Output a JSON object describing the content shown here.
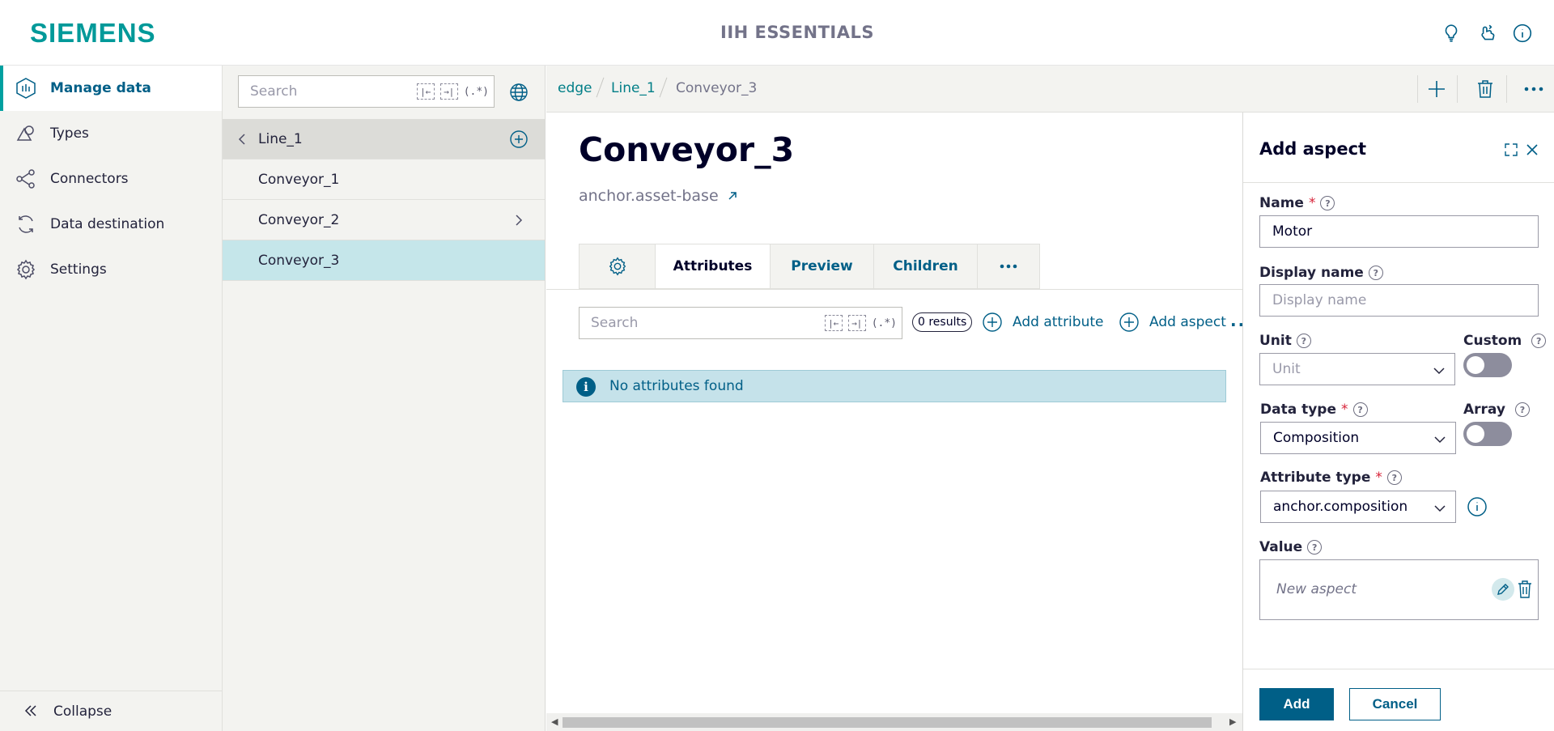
{
  "header": {
    "logo": "SIEMENS",
    "app_title": "IIH ESSENTIALS",
    "icons": [
      "lightbulb-icon",
      "user-support-icon",
      "info-icon"
    ]
  },
  "nav": {
    "items": [
      {
        "label": "Manage data",
        "icon": "manage-data-icon",
        "active": true
      },
      {
        "label": "Types",
        "icon": "types-icon",
        "active": false
      },
      {
        "label": "Connectors",
        "icon": "connectors-icon",
        "active": false
      },
      {
        "label": "Data destination",
        "icon": "data-destination-icon",
        "active": false
      },
      {
        "label": "Settings",
        "icon": "settings-icon",
        "active": false
      }
    ],
    "collapse_label": "Collapse"
  },
  "tree": {
    "search_placeholder": "Search",
    "regex_label": "(.*)",
    "parent": "Line_1",
    "items": [
      {
        "label": "Conveyor_1",
        "has_children": false,
        "selected": false
      },
      {
        "label": "Conveyor_2",
        "has_children": true,
        "selected": false
      },
      {
        "label": "Conveyor_3",
        "has_children": false,
        "selected": true
      }
    ]
  },
  "breadcrumb": {
    "items": [
      "edge",
      "Line_1",
      "Conveyor_3"
    ]
  },
  "main": {
    "title": "Conveyor_3",
    "subtitle": "anchor.asset-base",
    "tabs": [
      "Attributes",
      "Preview",
      "Children"
    ],
    "active_tab": "Attributes",
    "search_placeholder": "Search",
    "regex_label": "(.*)",
    "results": "0 results",
    "add_attribute": "Add attribute",
    "add_aspect": "Add aspect",
    "empty_message": "No attributes found"
  },
  "panel": {
    "title": "Add aspect",
    "name_label": "Name",
    "name_value": "Motor",
    "display_name_label": "Display name",
    "display_name_placeholder": "Display name",
    "unit_label": "Unit",
    "unit_placeholder": "Unit",
    "custom_label": "Custom",
    "custom_on": false,
    "data_type_label": "Data type",
    "data_type_value": "Composition",
    "array_label": "Array",
    "array_on": false,
    "attribute_type_label": "Attribute type",
    "attribute_type_value": "anchor.composition",
    "value_label": "Value",
    "value_placeholder": "New aspect",
    "add_button": "Add",
    "cancel_button": "Cancel"
  },
  "colors": {
    "brand": "#009999",
    "accent": "#005f87",
    "selected_row": "#c5e6ea",
    "required": "#d72339"
  }
}
